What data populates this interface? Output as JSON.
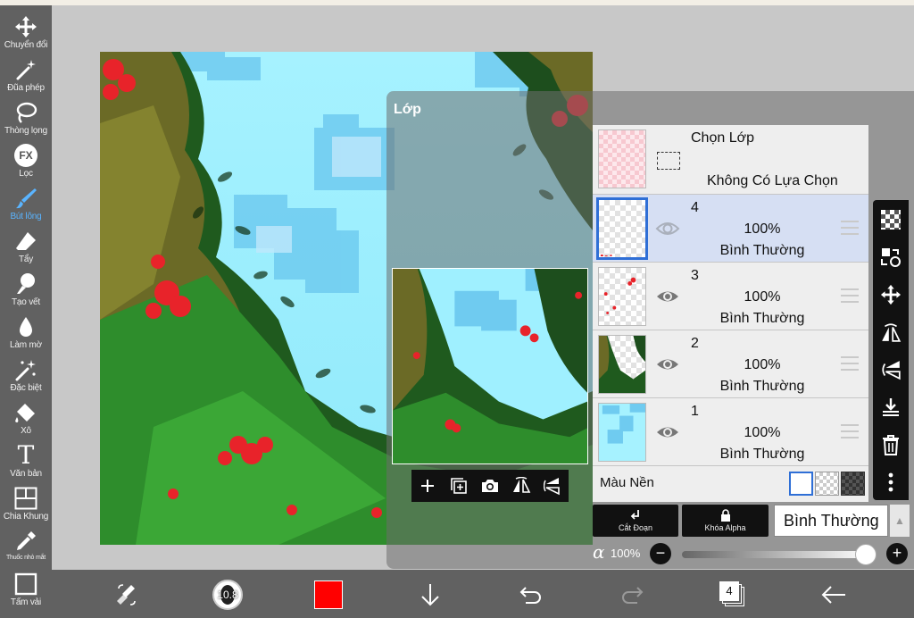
{
  "left_toolbar": {
    "tools": [
      {
        "label": "Chuyển đổi",
        "icon": "move-arrows-icon"
      },
      {
        "label": "Đũa phép",
        "icon": "magic-wand-icon"
      },
      {
        "label": "Thòng lọng",
        "icon": "lasso-icon"
      },
      {
        "label": "Lọc",
        "icon": "fx-filter-icon",
        "icon_text": "FX"
      },
      {
        "label": "Bút lông",
        "icon": "brush-icon",
        "active": true
      },
      {
        "label": "Tẩy",
        "icon": "eraser-icon"
      },
      {
        "label": "Tạo vết",
        "icon": "smudge-icon"
      },
      {
        "label": "Làm mờ",
        "icon": "blur-drop-icon"
      },
      {
        "label": "Đặc biệt",
        "icon": "special-sparkle-icon"
      },
      {
        "label": "Xô",
        "icon": "bucket-icon"
      },
      {
        "label": "Văn bản",
        "icon": "text-icon",
        "icon_text": "T"
      },
      {
        "label": "Chia Khung",
        "icon": "frame-divider-icon"
      },
      {
        "label": "Thuốc nhỏ mắt",
        "icon": "eyedropper-icon"
      },
      {
        "label": "Tấm vải",
        "icon": "canvas-icon"
      }
    ],
    "active_color": "#5ab4ff"
  },
  "layer_panel": {
    "title": "Lớp",
    "selection_row": {
      "title": "Chọn Lớp",
      "status": "Không Có Lựa Chọn"
    },
    "layers": [
      {
        "number": "4",
        "opacity": "100%",
        "blend": "Bình Thường",
        "selected": true,
        "visible": true
      },
      {
        "number": "3",
        "opacity": "100%",
        "blend": "Bình Thường",
        "selected": false,
        "visible": true
      },
      {
        "number": "2",
        "opacity": "100%",
        "blend": "Bình Thường",
        "selected": false,
        "visible": true
      },
      {
        "number": "1",
        "opacity": "100%",
        "blend": "Bình Thường",
        "selected": false,
        "visible": true
      }
    ],
    "background": {
      "label": "Màu Nền",
      "swatches": [
        "white",
        "transparent",
        "dark-checker"
      ],
      "selected_swatch": "white"
    },
    "clipping_label": "Cắt Đoạn",
    "alpha_lock_label": "Khóa Alpha",
    "blend_mode": "Bình Thường",
    "alpha_symbol": "α",
    "alpha_value": "100%",
    "selection_color": "#2f6fd6"
  },
  "bottom_bar": {
    "brush_size": "10.8",
    "layer_count": "4",
    "current_color": "#ff0000"
  }
}
